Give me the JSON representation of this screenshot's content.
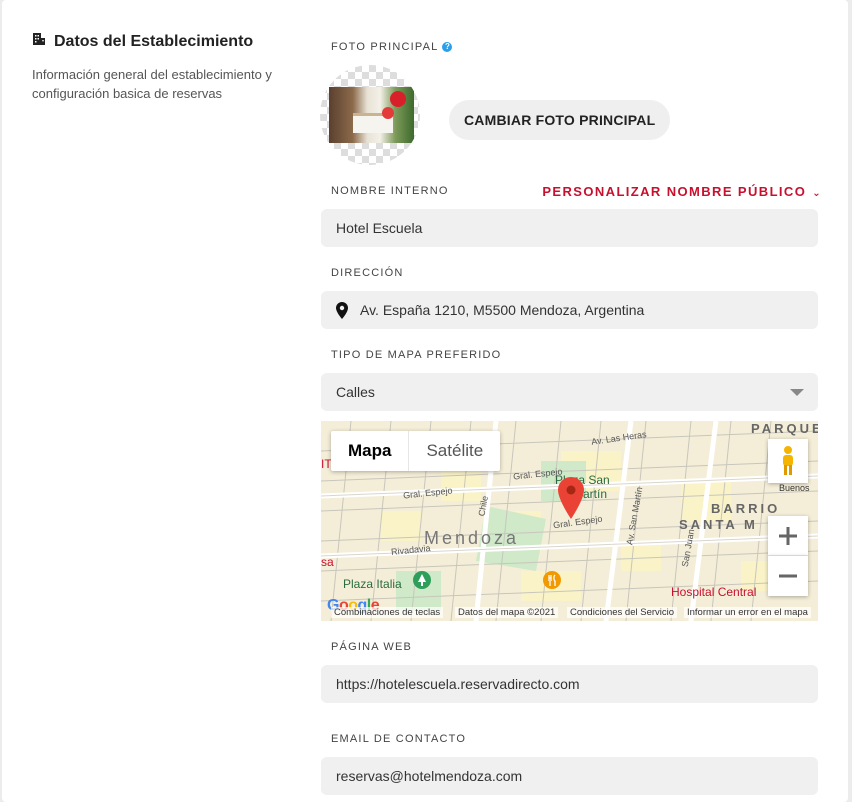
{
  "section": {
    "title": "Datos del Establecimiento",
    "description": "Información general del establecimiento y configuración basica de reservas"
  },
  "photo": {
    "label": "FOTO PRINCIPAL",
    "help": "?",
    "change_button": "CAMBIAR FOTO PRINCIPAL"
  },
  "name": {
    "label": "NOMBRE INTERNO",
    "customize_link": "PERSONALIZAR NOMBRE PÚBLICO",
    "value": "Hotel Escuela"
  },
  "address": {
    "label": "DIRECCIÓN",
    "value": "Av. España 1210, M5500 Mendoza, Argentina"
  },
  "map_type": {
    "label": "TIPO DE MAPA PREFERIDO",
    "selected": "Calles"
  },
  "map": {
    "type_buttons": [
      "Mapa",
      "Satélite"
    ],
    "labels": {
      "parque": "PARQUE",
      "barrio": "BARRIO",
      "santa": "SANTA M",
      "mendoza": "Mendoza",
      "plaza_san_martin_1": "Plaza San",
      "plaza_san_martin_2": "Martín",
      "plaza_italia": "Plaza Italia",
      "hospital": "Hospital Central",
      "buenos": "Buenos",
      "las_heras": "Av. Las Heras",
      "espejo1": "Gral. Espejo",
      "espejo2": "Gral. Espejo",
      "espejo3": "Gral. Espejo",
      "chile": "Chile",
      "san_martin": "Av. San Martín",
      "rivadavia": "Rivadavia",
      "san_juan": "San Juan",
      "sa": "sa",
      "it": "IT"
    },
    "footer": {
      "shortcuts": "Combinaciones de teclas",
      "data": "Datos del mapa ©2021",
      "terms": "Condiciones del Servicio",
      "report": "Informar un error en el mapa"
    },
    "google": "Google"
  },
  "website": {
    "label": "PÁGINA WEB",
    "value": "https://hotelescuela.reservadirecto.com"
  },
  "email": {
    "label": "EMAIL DE CONTACTO",
    "value": "reservas@hotelmendoza.com"
  },
  "colors": {
    "accent_red": "#c8102e",
    "help_blue": "#2aa0e8",
    "field_bg": "#f0f0f0"
  }
}
